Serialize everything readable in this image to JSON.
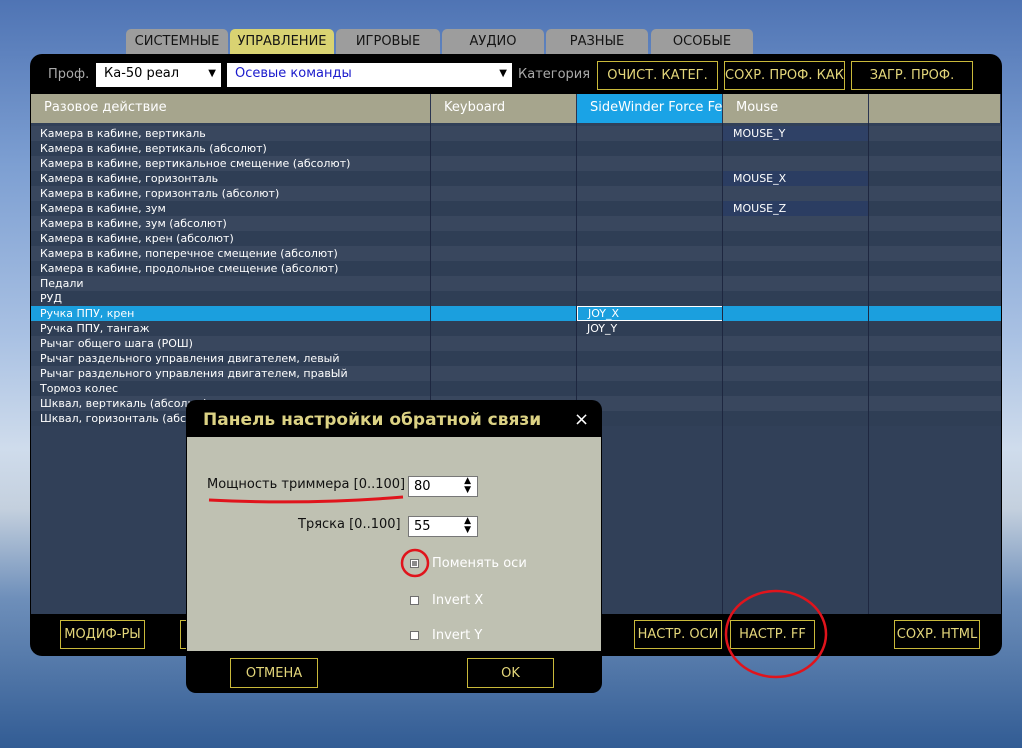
{
  "tabs": [
    {
      "label": "СИСТЕМНЫЕ",
      "active": false
    },
    {
      "label": "УПРАВЛЕНИЕ",
      "active": true
    },
    {
      "label": "ИГРОВЫЕ",
      "active": false
    },
    {
      "label": "АУДИО",
      "active": false
    },
    {
      "label": "РАЗНЫЕ",
      "active": false
    },
    {
      "label": "ОСОБЫЕ",
      "active": false
    }
  ],
  "toolbar": {
    "profile_label": "Проф.",
    "profile_value": "Ка-50 реал",
    "axis_value": "Осевые команды",
    "category_label": "Категория",
    "clear_cat": "ОЧИСТ. КАТЕГ.",
    "save_as": "СОХР. ПРОФ. КАК",
    "load": "ЗАГР. ПРОФ."
  },
  "columns": [
    "Разовое действие",
    "Keyboard",
    "SideWinder Force Fee",
    "Mouse",
    ""
  ],
  "rows": [
    {
      "name": "Камера в кабине, вертикаль",
      "ff": "",
      "mouse": "MOUSE_Y"
    },
    {
      "name": "Камера в кабине, вертикаль (абсолют)",
      "ff": "",
      "mouse": ""
    },
    {
      "name": "Камера в кабине, вертикальное смещение (абсолют)",
      "ff": "",
      "mouse": ""
    },
    {
      "name": "Камера в кабине, горизонталь",
      "ff": "",
      "mouse": "MOUSE_X"
    },
    {
      "name": "Камера в кабине, горизонталь (абсолют)",
      "ff": "",
      "mouse": ""
    },
    {
      "name": "Камера в кабине, зум",
      "ff": "",
      "mouse": "MOUSE_Z"
    },
    {
      "name": "Камера в кабине, зум (абсолют)",
      "ff": "",
      "mouse": ""
    },
    {
      "name": "Камера в кабине, крен (абсолют)",
      "ff": "",
      "mouse": ""
    },
    {
      "name": "Камера в кабине, поперечное смещение (абсолют)",
      "ff": "",
      "mouse": ""
    },
    {
      "name": "Камера в кабине, продольное смещение (абсолют)",
      "ff": "",
      "mouse": ""
    },
    {
      "name": "Педали",
      "ff": "",
      "mouse": ""
    },
    {
      "name": "РУД",
      "ff": "",
      "mouse": ""
    },
    {
      "name": "Ручка ППУ, крен",
      "ff": "JOY_X",
      "mouse": ""
    },
    {
      "name": "Ручка ППУ, тангаж",
      "ff": "JOY_Y",
      "mouse": ""
    },
    {
      "name": "Рычаг общего шага (РОШ)",
      "ff": "",
      "mouse": ""
    },
    {
      "name": "Рычаг раздельного управления двигателем, левый",
      "ff": "",
      "mouse": ""
    },
    {
      "name": "Рычаг раздельного управления двигателем, правЫй",
      "ff": "",
      "mouse": ""
    },
    {
      "name": "Тормоз колес",
      "ff": "",
      "mouse": ""
    },
    {
      "name": "Шквал, вертикаль (абсолют)",
      "ff": "",
      "mouse": ""
    },
    {
      "name": "Шквал, горизонталь (абсолют)",
      "ff": "",
      "mouse": ""
    }
  ],
  "selected_row": 12,
  "bottom": {
    "modifiers": "МОДИФ-РЫ",
    "axis_settings": "НАСТР. ОСИ",
    "ff_settings": "НАСТР. FF",
    "save_html": "СОХР. HTML"
  },
  "dialog": {
    "title": "Панель настройки обратной связи",
    "close": "×",
    "trimmer_label": "Мощность триммера [0..100]",
    "trimmer_value": "80",
    "shake_label": "Тряска [0..100]",
    "shake_value": "55",
    "swap_axes": "Поменять оси",
    "swap_checked": true,
    "invert_x": "Invert X",
    "invert_x_checked": false,
    "invert_y": "Invert Y",
    "invert_y_checked": false,
    "cancel": "ОТМЕНА",
    "ok": "OK"
  },
  "colors": {
    "accent_yellow": "#d9d372",
    "selected_row": "#1b9fde",
    "annotation_red": "#e0141c"
  }
}
